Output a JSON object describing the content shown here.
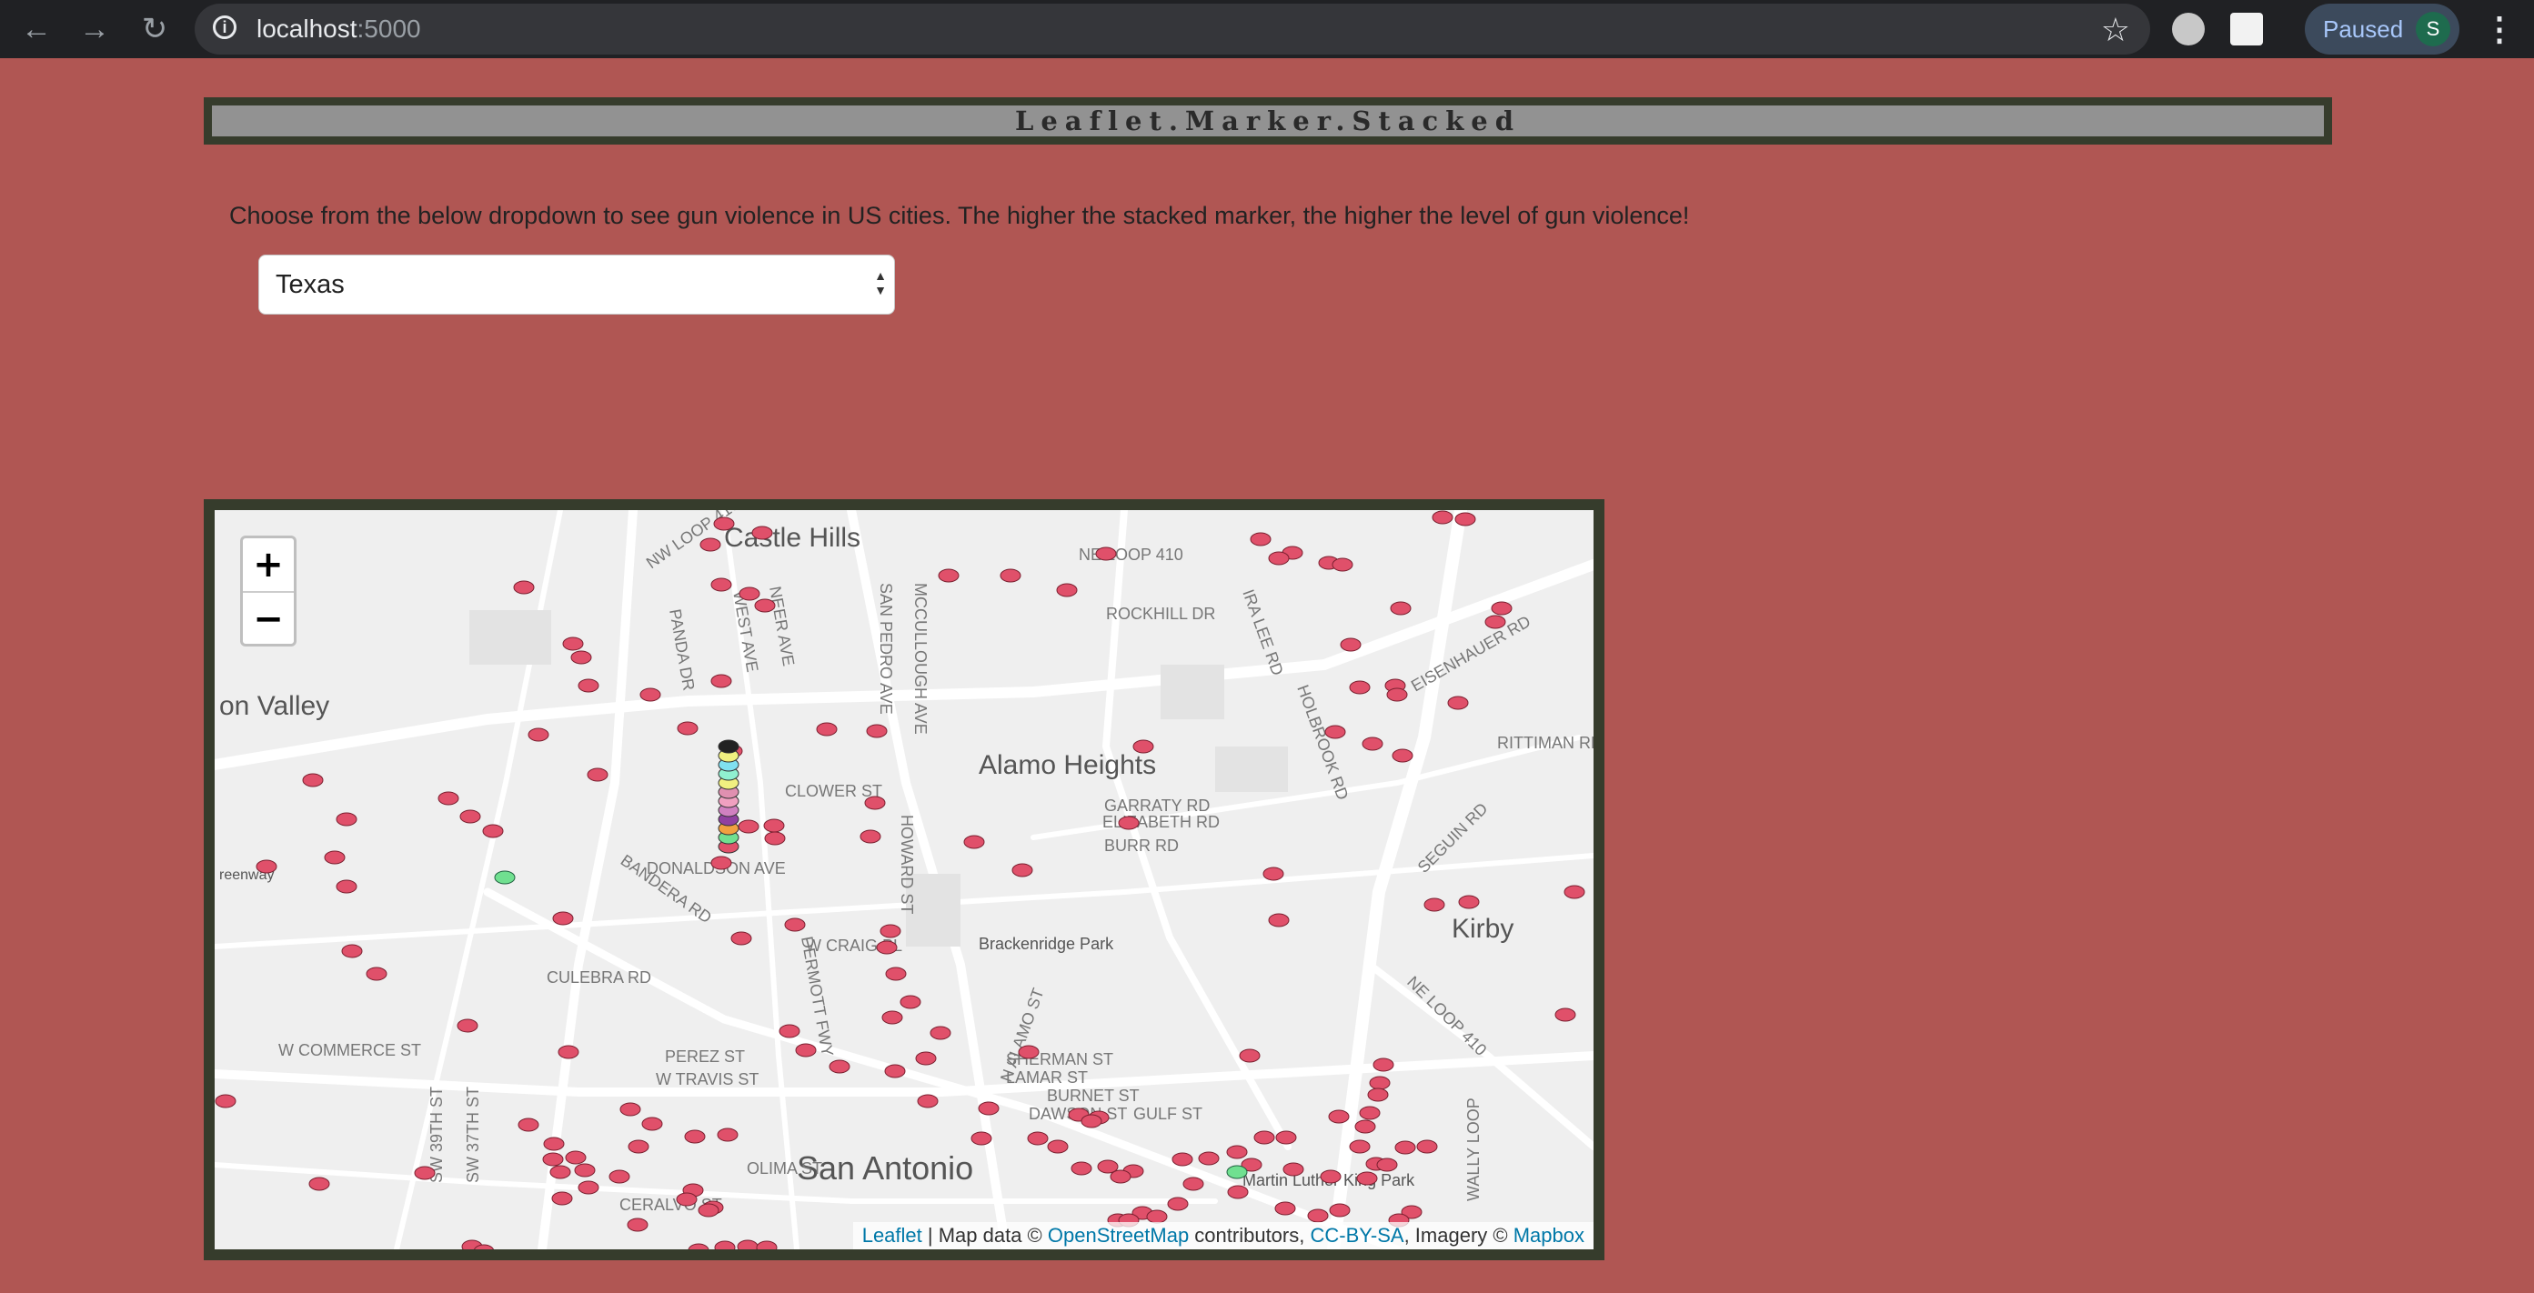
{
  "browser": {
    "url_host": "localhost",
    "url_port": ":5000",
    "profile_status": "Paused",
    "avatar_letter": "S"
  },
  "page": {
    "title": "Leaflet.Marker.Stacked",
    "instructions": "Choose from the below dropdown to see gun violence in US cities. The higher the stacked marker, the higher the level of gun violence!",
    "dropdown": {
      "selected": "Texas"
    }
  },
  "map": {
    "zoom_in": "+",
    "zoom_out": "−",
    "place_labels": [
      "Castle Hills",
      "on Valley",
      "Alamo Heights",
      "Kirby",
      "San Antonio",
      "Brackenridge Park",
      "Martin Luther King Park",
      "reenway"
    ],
    "street_labels": [
      "NE LOOP 410",
      "ROCKHILL DR",
      "IRA LEE RD",
      "EISENHAUER RD",
      "HOLBROOK RD",
      "RITTIMAN RD",
      "NW LOOP 410",
      "PANDA DR",
      "WEST AVE",
      "NEER AVE",
      "SAN PEDRO AVE",
      "MCCULLOUGH AVE",
      "CLOWER ST",
      "GARRATY RD",
      "ELIZABETH RD",
      "BURR RD",
      "HOWARD ST",
      "DONALDSON AVE",
      "BANDERA RD",
      "SEGUIN RD",
      "W CRAIG PL",
      "CULEBRA RD",
      "DERMOTT FWY",
      "NE LOOP 410",
      "N ALAMO ST",
      "SHERMAN ST",
      "LAMAR ST",
      "BURNET ST",
      "DAWSON ST",
      "GULF ST",
      "W COMMERCE ST",
      "PEREZ ST",
      "W TRAVIS ST",
      "SW 39TH ST",
      "SW 37TH ST",
      "OLIMA ST",
      "CERALVO ST",
      "WALLY LOOP"
    ],
    "attribution": {
      "leaflet": "Leaflet",
      "sep1": " | Map data © ",
      "osm": "OpenStreetMap",
      "sep2": " contributors, ",
      "license": "CC-BY-SA",
      "sep3": ", Imagery © ",
      "mapbox": "Mapbox"
    },
    "marker_color": "#e0506a",
    "stack_colors": [
      "#222222",
      "#f0f080",
      "#80e0f0",
      "#90f0d0",
      "#f0f080",
      "#e090b0",
      "#f0a0c0",
      "#d080c0",
      "#9040a0",
      "#f0a040",
      "#70e090",
      "#e0506a"
    ]
  }
}
